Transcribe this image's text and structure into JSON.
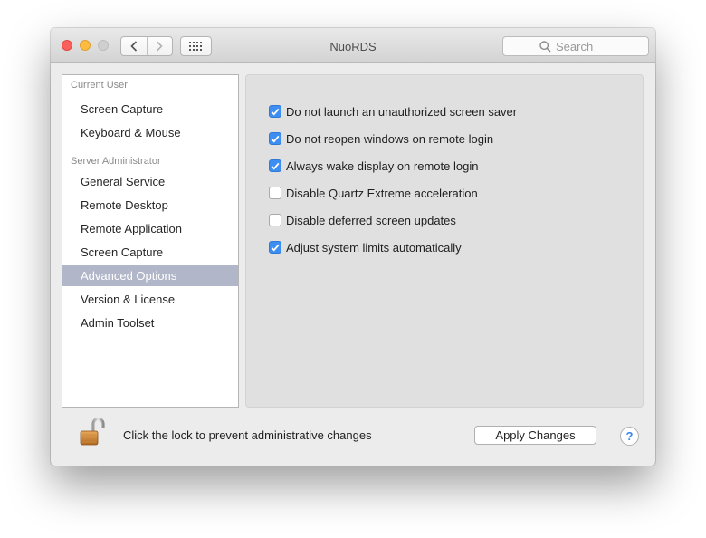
{
  "window": {
    "title": "NuoRDS"
  },
  "toolbar": {
    "search_placeholder": "Search"
  },
  "sidebar": {
    "sections": [
      {
        "header": "Current User",
        "items": [
          "Screen Capture",
          "Keyboard & Mouse"
        ]
      },
      {
        "header": "Server Administrator",
        "items": [
          "General Service",
          "Remote Desktop",
          "Remote Application",
          "Screen Capture",
          "Advanced Options",
          "Version & License",
          "Admin Toolset"
        ]
      }
    ],
    "selected": "Advanced Options"
  },
  "options": [
    {
      "label": "Do not launch an unauthorized screen saver",
      "checked": true
    },
    {
      "label": "Do not reopen windows on remote login",
      "checked": true
    },
    {
      "label": "Always wake display on remote login",
      "checked": true
    },
    {
      "label": "Disable Quartz Extreme acceleration",
      "checked": false
    },
    {
      "label": "Disable deferred screen updates",
      "checked": false
    },
    {
      "label": "Adjust system limits automatically",
      "checked": true
    }
  ],
  "footer": {
    "lock_text": "Click the lock to prevent administrative changes",
    "apply_label": "Apply Changes",
    "help_label": "?"
  },
  "colors": {
    "accent": "#3d8ef2",
    "selection": "#b1b6c8",
    "close": "#fc605c",
    "minimize": "#fdbc40"
  },
  "icons": [
    "back-chevron-icon",
    "forward-chevron-icon",
    "grid-icon",
    "search-icon",
    "checkmark-icon",
    "padlock-icon"
  ]
}
